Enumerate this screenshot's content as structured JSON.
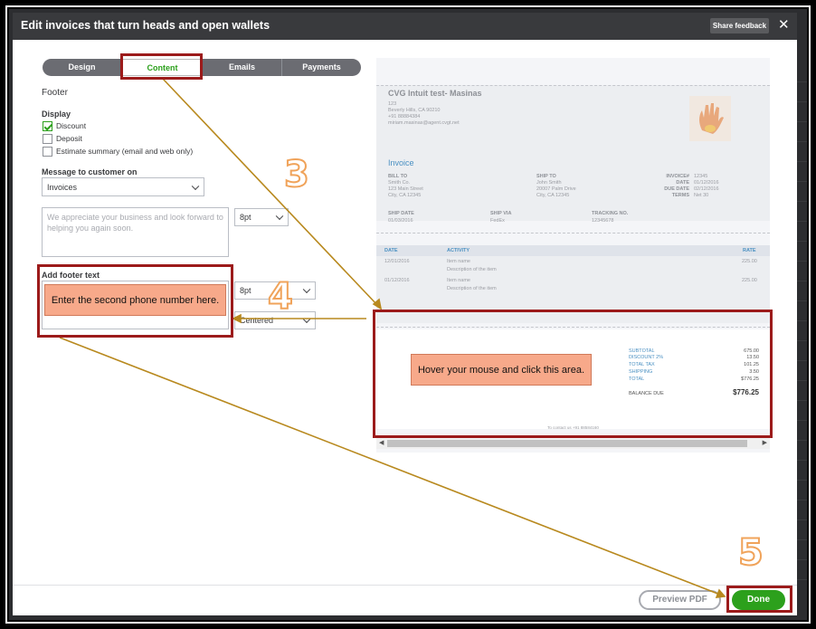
{
  "modal": {
    "title": "Edit invoices that turn heads and open wallets",
    "share_feedback": "Share feedback",
    "close": "✕"
  },
  "tabs": [
    {
      "label": "Design"
    },
    {
      "label": "Content",
      "active": true
    },
    {
      "label": "Emails"
    },
    {
      "label": "Payments"
    }
  ],
  "form": {
    "section": "Footer",
    "display_label": "Display",
    "checkboxes": [
      {
        "label": "Discount",
        "checked": true
      },
      {
        "label": "Deposit",
        "checked": false
      },
      {
        "label": "Estimate summary (email and web only)",
        "checked": false
      }
    ],
    "message_label": "Message to customer on",
    "message_select": "Invoices",
    "message_placeholder": "We appreciate your business and look forward to helping you again soon.",
    "message_font_size": "8pt",
    "footer_label": "Add footer text",
    "footer_font_size": "8pt",
    "footer_align": "Centered"
  },
  "preview": {
    "company": "CVG Intuit test- Masinas",
    "address": [
      "123",
      "Beverly Hills, CA 90210",
      "+91 88884384",
      "miriam.masinas@agent.cvgt.net"
    ],
    "doc_title": "Invoice",
    "bill_to_label": "BILL TO",
    "bill_to": [
      "Smith Co.",
      "123 Main Street",
      "City, CA 12345"
    ],
    "ship_to_label": "SHIP TO",
    "ship_to": [
      "John Smith",
      "20007 Palm Drive",
      "City, CA 12345"
    ],
    "meta_labels": [
      "INVOICE#",
      "DATE",
      "DUE DATE",
      "TERMS"
    ],
    "meta_values": [
      "12345",
      "01/12/2016",
      "02/12/2016",
      "Net 30"
    ],
    "ship_date_label": "SHIP DATE",
    "ship_date": "01/03/2016",
    "ship_via_label": "SHIP VIA",
    "ship_via": "FedEx",
    "tracking_label": "TRACKING NO.",
    "tracking": "12345678",
    "col_date": "DATE",
    "col_activity": "ACTIVITY",
    "col_rate": "RATE",
    "rows": [
      {
        "date": "12/01/2016",
        "item": "Item name",
        "desc": "Description of the item",
        "amount": "225.00"
      },
      {
        "date": "01/12/2016",
        "item": "Item name",
        "desc": "Description of the item",
        "amount": "225.00"
      }
    ],
    "totals": [
      {
        "label": "SUBTOTAL",
        "value": "675.00"
      },
      {
        "label": "DISCOUNT 2%",
        "value": "13.50"
      },
      {
        "label": "TOTAL TAX",
        "value": "101.25"
      },
      {
        "label": "SHIPPING",
        "value": "3.50"
      },
      {
        "label": "TOTAL",
        "value": "$776.25"
      }
    ],
    "balance_label": "BALANCE DUE",
    "balance_value": "$776.25",
    "footer_text": "To contact us +91 88584160"
  },
  "footer": {
    "preview_pdf": "Preview PDF",
    "done": "Done"
  },
  "annotations": {
    "step3": "3",
    "step4": "4",
    "step5": "5",
    "callout_footer": "Enter the second phone number here.",
    "callout_preview": "Hover your mouse and click this area."
  }
}
